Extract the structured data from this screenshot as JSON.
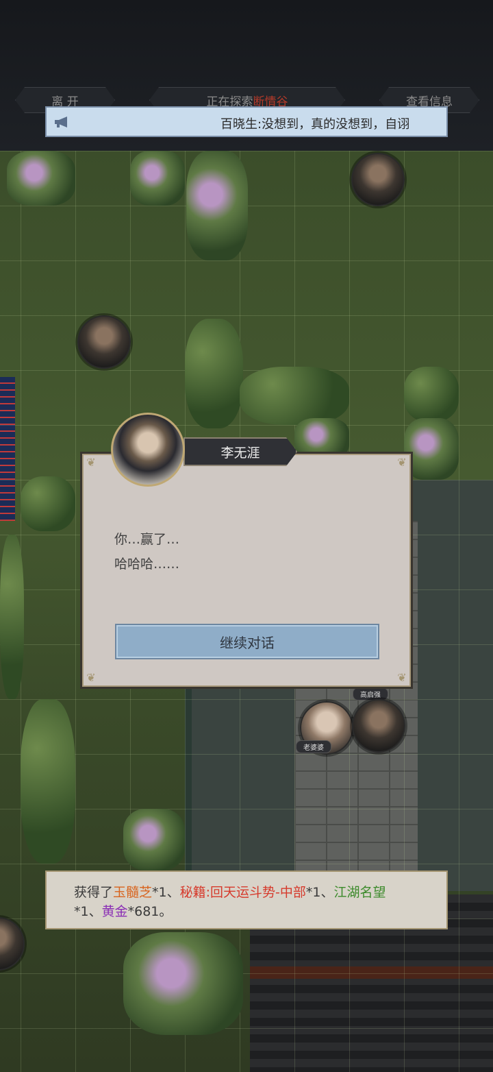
{
  "top_bar": {
    "leave_label": "离  开",
    "exploring_prefix": "正在探索",
    "exploring_location": "断情谷",
    "info_label": "查看信息"
  },
  "announcement": {
    "icon": "megaphone-icon",
    "text": "百晓生:没想到，真的没想到，自诩"
  },
  "npc_tags": {
    "granny": "老婆婆",
    "top": "高启强"
  },
  "dialog": {
    "speaker": "李无涯",
    "line1": "你…赢了…",
    "line2": "哈哈哈……",
    "continue_label": "继续对话"
  },
  "reward": {
    "prefix": "获得了",
    "item1_name": "玉髓芝",
    "item1_qty": "*1、",
    "item2_name": "秘籍:回天运斗势-中部",
    "item2_qty": "*1、",
    "item3_name": "江湖名望",
    "item3_qty": "*1、",
    "item4_name": "黄金",
    "item4_qty": "*681。"
  },
  "colors": {
    "location_red": "#b33a2a",
    "reward_orange": "#d8641e",
    "reward_red": "#d63a2c",
    "reward_green": "#3b8a2a",
    "reward_purple": "#8a2eb5",
    "button_blue": "#8fadc8"
  }
}
